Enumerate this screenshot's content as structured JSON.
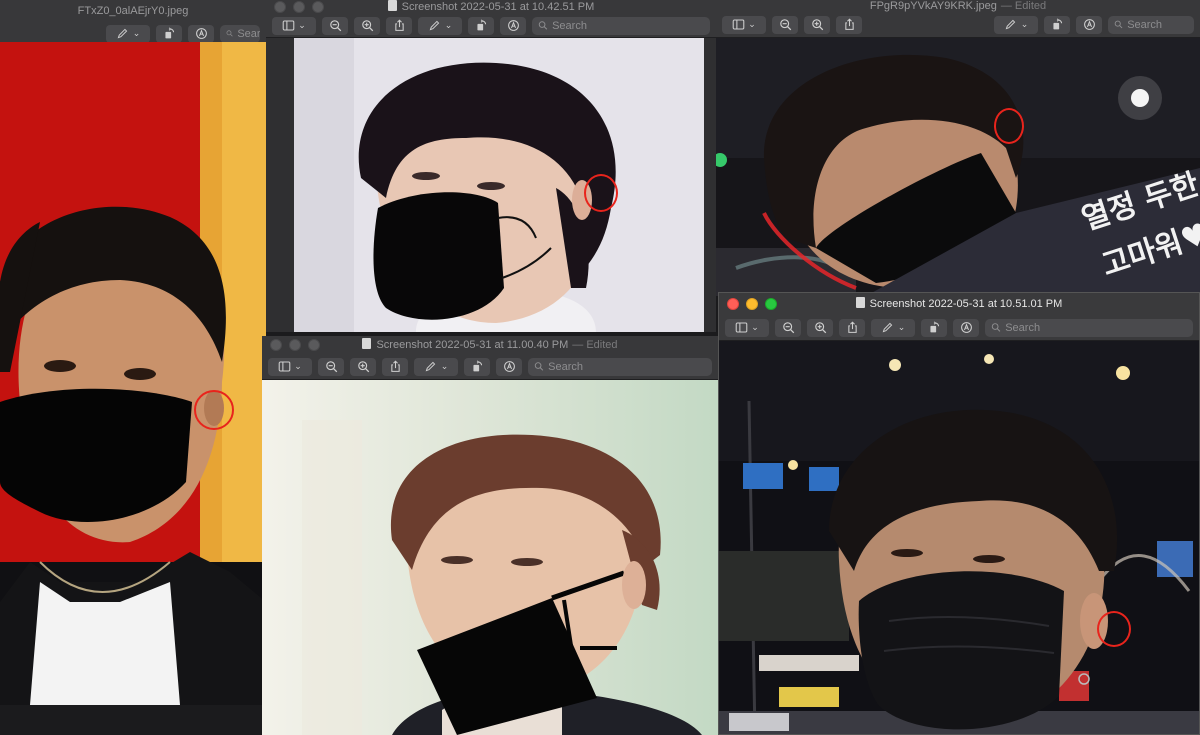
{
  "windows": {
    "w1": {
      "title": "FTxZ0_0alAEjrY0.jpeg",
      "search_placeholder": "Search"
    },
    "w2": {
      "title": "Screenshot 2022-05-31 at 10.42.51 PM",
      "search_placeholder": "Search"
    },
    "w3": {
      "title": "FPgR9pYVkAY9KRK.jpeg",
      "edited": "— Edited",
      "search_placeholder": "Search"
    },
    "w4": {
      "title": "Screenshot 2022-05-31 at 11.00.40 PM",
      "edited": "— Edited",
      "search_placeholder": "Search"
    },
    "w5": {
      "title": "Screenshot 2022-05-31 at 10.51.01 PM",
      "search_placeholder": "Search"
    }
  },
  "sign_text": {
    "line1": "열정 두한 오늘",
    "line2": "고마워♥"
  },
  "icons": [
    "sidebar-icon",
    "zoom-out-icon",
    "zoom-in-icon",
    "share-icon",
    "markup-pen-icon",
    "rotate-icon",
    "annotate-icon",
    "search-icon"
  ],
  "colors": {
    "annotation": "#e8241c",
    "accent": "#0a84ff"
  }
}
